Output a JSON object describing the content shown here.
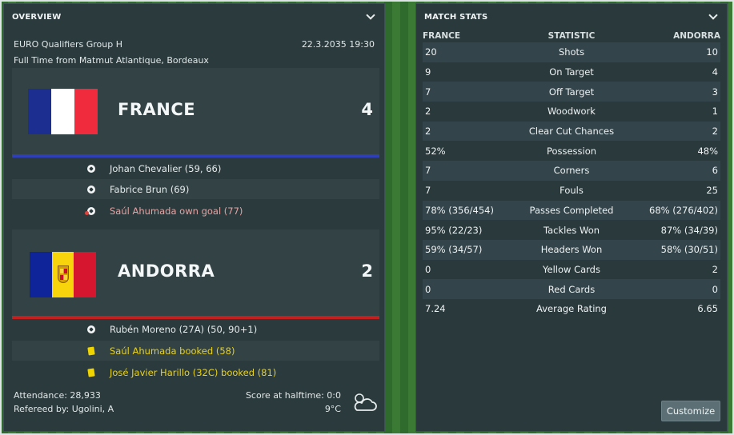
{
  "overview": {
    "title": "OVERVIEW",
    "competition": "EURO Qualifiers Group H",
    "datetime": "22.3.2035 19:30",
    "venue": "Full Time from Matmut Atlantique, Bordeaux",
    "home": {
      "name": "FRANCE",
      "score": "4",
      "bar_color": "#2f3fb6",
      "events": [
        {
          "icon": "ball-icon",
          "text": "Johan Chevalier (59, 66)",
          "color": "#e8edee"
        },
        {
          "icon": "ball-icon",
          "text": "Fabrice Brun (69)",
          "color": "#e8edee"
        },
        {
          "icon": "own-goal-icon",
          "text": "Saúl Ahumada own goal (77)",
          "color": "#e7a3a3"
        }
      ]
    },
    "away": {
      "name": "ANDORRA",
      "score": "2",
      "bar_color": "#c41e1e",
      "events": [
        {
          "icon": "ball-icon",
          "text": "Rubén Moreno (27A) (50, 90+1)",
          "color": "#e8edee"
        },
        {
          "icon": "yellow-card-icon",
          "text": "Saúl Ahumada booked (58)",
          "color": "#e9d21a"
        },
        {
          "icon": "yellow-card-icon",
          "text": "José Javier Harillo (32C) booked (81)",
          "color": "#e9d21a"
        }
      ]
    },
    "attendance": "Attendance: 28,933",
    "referee": "Refereed by: Ugolini, A",
    "halftime": "Score at halftime: 0:0",
    "temperature": "9°C",
    "weather_icon": "cloud-icon"
  },
  "stats": {
    "title": "MATCH STATS",
    "head_home": "FRANCE",
    "head_stat": "STATISTIC",
    "head_away": "ANDORRA",
    "rows": [
      {
        "home": "20",
        "label": "Shots",
        "away": "10"
      },
      {
        "home": "9",
        "label": "On Target",
        "away": "4"
      },
      {
        "home": "7",
        "label": "Off Target",
        "away": "3"
      },
      {
        "home": "2",
        "label": "Woodwork",
        "away": "1"
      },
      {
        "home": "2",
        "label": "Clear Cut Chances",
        "away": "2"
      },
      {
        "home": "52%",
        "label": "Possession",
        "away": "48%"
      },
      {
        "home": "7",
        "label": "Corners",
        "away": "6"
      },
      {
        "home": "7",
        "label": "Fouls",
        "away": "25"
      },
      {
        "home": "78% (356/454)",
        "label": "Passes Completed",
        "away": "68% (276/402)"
      },
      {
        "home": "95% (22/23)",
        "label": "Tackles Won",
        "away": "87% (34/39)"
      },
      {
        "home": "59% (34/57)",
        "label": "Headers Won",
        "away": "58% (30/51)"
      },
      {
        "home": "0",
        "label": "Yellow Cards",
        "away": "2"
      },
      {
        "home": "0",
        "label": "Red Cards",
        "away": "0"
      },
      {
        "home": "7.24",
        "label": "Average Rating",
        "away": "6.65"
      }
    ],
    "customize_label": "Customize"
  }
}
